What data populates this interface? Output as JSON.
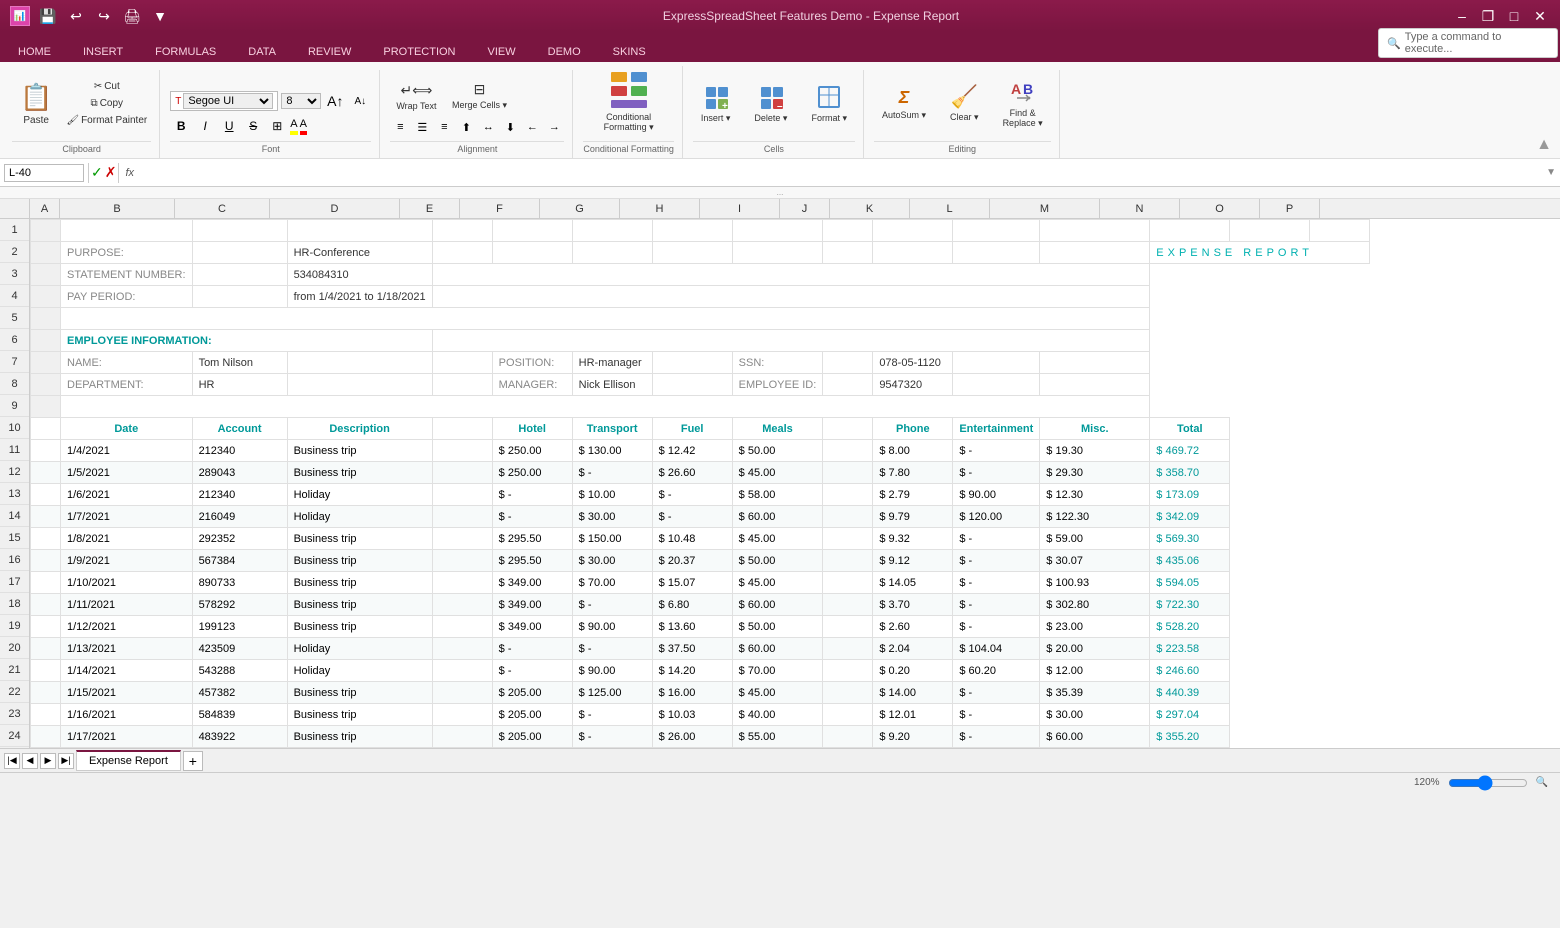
{
  "titleBar": {
    "title": "ExpressSpreadSheet Features Demo - Expense Report",
    "controlMin": "–",
    "controlRestore": "❐",
    "controlMax": "□",
    "controlClose": "✕"
  },
  "tabs": [
    "HOME",
    "INSERT",
    "FORMULAS",
    "DATA",
    "REVIEW",
    "PROTECTION",
    "VIEW",
    "DEMO",
    "SKINS"
  ],
  "activeTab": "HOME",
  "commandPlaceholder": "Type a command to execute...",
  "ribbon": {
    "groups": {
      "clipboard": {
        "label": "Clipboard",
        "paste": "Paste",
        "cut": "✂ Cut",
        "copy": "Copy",
        "formatPainter": "Format Painter"
      },
      "font": {
        "label": "Font",
        "fontFamily": "Segoe UI",
        "fontSize": "8"
      },
      "alignment": {
        "label": "Alignment",
        "wrapText": "Wrap Text",
        "mergeCells": "Merge Cells"
      },
      "conditionalFormatting": {
        "label": "Conditional Formatting",
        "btnLabel": "Conditional\nFormatting"
      },
      "cells": {
        "label": "Cells",
        "insert": "Insert",
        "delete": "Delete",
        "format": "Format"
      },
      "editing": {
        "label": "Editing",
        "autoSum": "AutoSum",
        "clear": "Clear",
        "findReplace": "Find &\nReplace"
      }
    }
  },
  "formulaBar": {
    "nameBox": "L-40",
    "formula": ""
  },
  "collapseBar": "...",
  "columns": [
    "A",
    "B",
    "C",
    "D",
    "E",
    "F",
    "G",
    "H",
    "I",
    "J",
    "K",
    "L",
    "M",
    "N",
    "O",
    "P"
  ],
  "sheet": {
    "title": "EXPENSE REPORT",
    "purpose": {
      "label": "PURPOSE:",
      "value": "HR-Conference"
    },
    "statementNumber": {
      "label": "STATEMENT NUMBER:",
      "value": "534084310"
    },
    "payPeriod": {
      "label": "PAY PERIOD:",
      "value": "from 1/4/2021 to 1/18/2021"
    },
    "employeeInfo": {
      "sectionLabel": "EMPLOYEE INFORMATION:",
      "name": {
        "label": "NAME:",
        "value": "Tom Nilson"
      },
      "department": {
        "label": "DEPARTMENT:",
        "value": "HR"
      },
      "position": {
        "label": "POSITION:",
        "value": "HR-manager"
      },
      "manager": {
        "label": "MANAGER:",
        "value": "Nick Ellison"
      },
      "ssn": {
        "label": "SSN:",
        "value": "078-05-1120"
      },
      "employeeId": {
        "label": "EMPLOYEE ID:",
        "value": "9547320"
      }
    },
    "tableHeaders": [
      "Date",
      "Account",
      "Description",
      "Hotel",
      "Transport",
      "Fuel",
      "Meals",
      "Phone",
      "Entertainment",
      "Misc.",
      "Total"
    ],
    "rows": [
      [
        "1/4/2021",
        "212340",
        "Business trip",
        "$ 250.00",
        "$ 130.00",
        "$ 12.42",
        "$ 50.00",
        "$ 8.00",
        "$ -",
        "$ 19.30",
        "$ 469.72"
      ],
      [
        "1/5/2021",
        "289043",
        "Business trip",
        "$ 250.00",
        "$ -",
        "$ 26.60",
        "$ 45.00",
        "$ 7.80",
        "$ -",
        "$ 29.30",
        "$ 358.70"
      ],
      [
        "1/6/2021",
        "212340",
        "Holiday",
        "$ -",
        "$ 10.00",
        "$ -",
        "$ 58.00",
        "$ 2.79",
        "$ 90.00",
        "$ 12.30",
        "$ 173.09"
      ],
      [
        "1/7/2021",
        "216049",
        "Holiday",
        "$ -",
        "$ 30.00",
        "$ -",
        "$ 60.00",
        "$ 9.79",
        "$ 120.00",
        "$ 122.30",
        "$ 342.09"
      ],
      [
        "1/8/2021",
        "292352",
        "Business trip",
        "$ 295.50",
        "$ 150.00",
        "$ 10.48",
        "$ 45.00",
        "$ 9.32",
        "$ -",
        "$ 59.00",
        "$ 569.30"
      ],
      [
        "1/9/2021",
        "567384",
        "Business trip",
        "$ 295.50",
        "$ 30.00",
        "$ 20.37",
        "$ 50.00",
        "$ 9.12",
        "$ -",
        "$ 30.07",
        "$ 435.06"
      ],
      [
        "1/10/2021",
        "890733",
        "Business trip",
        "$ 349.00",
        "$ 70.00",
        "$ 15.07",
        "$ 45.00",
        "$ 14.05",
        "$ -",
        "$ 100.93",
        "$ 594.05"
      ],
      [
        "1/11/2021",
        "578292",
        "Business trip",
        "$ 349.00",
        "$ -",
        "$ 6.80",
        "$ 60.00",
        "$ 3.70",
        "$ -",
        "$ 302.80",
        "$ 722.30"
      ],
      [
        "1/12/2021",
        "199123",
        "Business trip",
        "$ 349.00",
        "$ 90.00",
        "$ 13.60",
        "$ 50.00",
        "$ 2.60",
        "$ -",
        "$ 23.00",
        "$ 528.20"
      ],
      [
        "1/13/2021",
        "423509",
        "Holiday",
        "$ -",
        "$ -",
        "$ 37.50",
        "$ 60.00",
        "$ 2.04",
        "$ 104.04",
        "$ 20.00",
        "$ 223.58"
      ],
      [
        "1/14/2021",
        "543288",
        "Holiday",
        "$ -",
        "$ 90.00",
        "$ 14.20",
        "$ 70.00",
        "$ 0.20",
        "$ 60.20",
        "$ 12.00",
        "$ 246.60"
      ],
      [
        "1/15/2021",
        "457382",
        "Business trip",
        "$ 205.00",
        "$ 125.00",
        "$ 16.00",
        "$ 45.00",
        "$ 14.00",
        "$ -",
        "$ 35.39",
        "$ 440.39"
      ],
      [
        "1/16/2021",
        "584839",
        "Business trip",
        "$ 205.00",
        "$ -",
        "$ 10.03",
        "$ 40.00",
        "$ 12.01",
        "$ -",
        "$ 30.00",
        "$ 297.04"
      ],
      [
        "1/17/2021",
        "483922",
        "Business trip",
        "$ 205.00",
        "$ -",
        "$ 26.00",
        "$ 55.00",
        "$ 9.20",
        "$ -",
        "$ 60.00",
        "$ 355.20"
      ]
    ]
  },
  "sheetTabs": [
    "Expense Report"
  ],
  "statusBar": {
    "zoom": "120%"
  }
}
